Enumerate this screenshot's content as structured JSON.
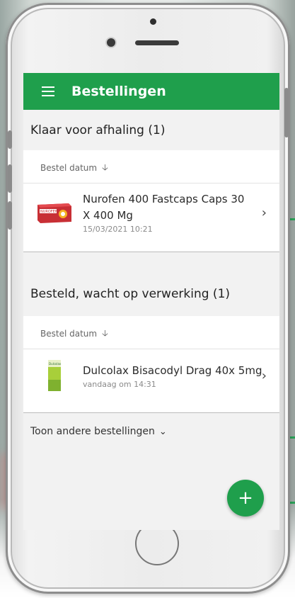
{
  "appbar": {
    "title": "Bestellingen"
  },
  "sections": [
    {
      "title": "Klaar voor afhaling (1)",
      "sort_label": "Bestel datum",
      "items": [
        {
          "name": "Nurofen 400 Fastcaps Caps 30 X 400 Mg",
          "date": "15/03/2021 10:21"
        }
      ]
    },
    {
      "title": "Besteld, wacht op verwerking (1)",
      "sort_label": "Bestel datum",
      "items": [
        {
          "name": "Dulcolax Bisacodyl Drag 40x 5mg",
          "date": "vandaag om 14:31"
        }
      ]
    }
  ],
  "more_label": "Toon andere bestellingen",
  "fab_label": "+",
  "product_art": {
    "nurofen_pack": "NUROFEN",
    "dulcolax_pack": "Dulcolax"
  },
  "colors": {
    "brand_green": "#1f9f4c"
  },
  "icons": [
    "menu-icon",
    "sort-down-arrow-icon",
    "chevron-right-icon",
    "chevron-down-icon",
    "plus-icon"
  ]
}
